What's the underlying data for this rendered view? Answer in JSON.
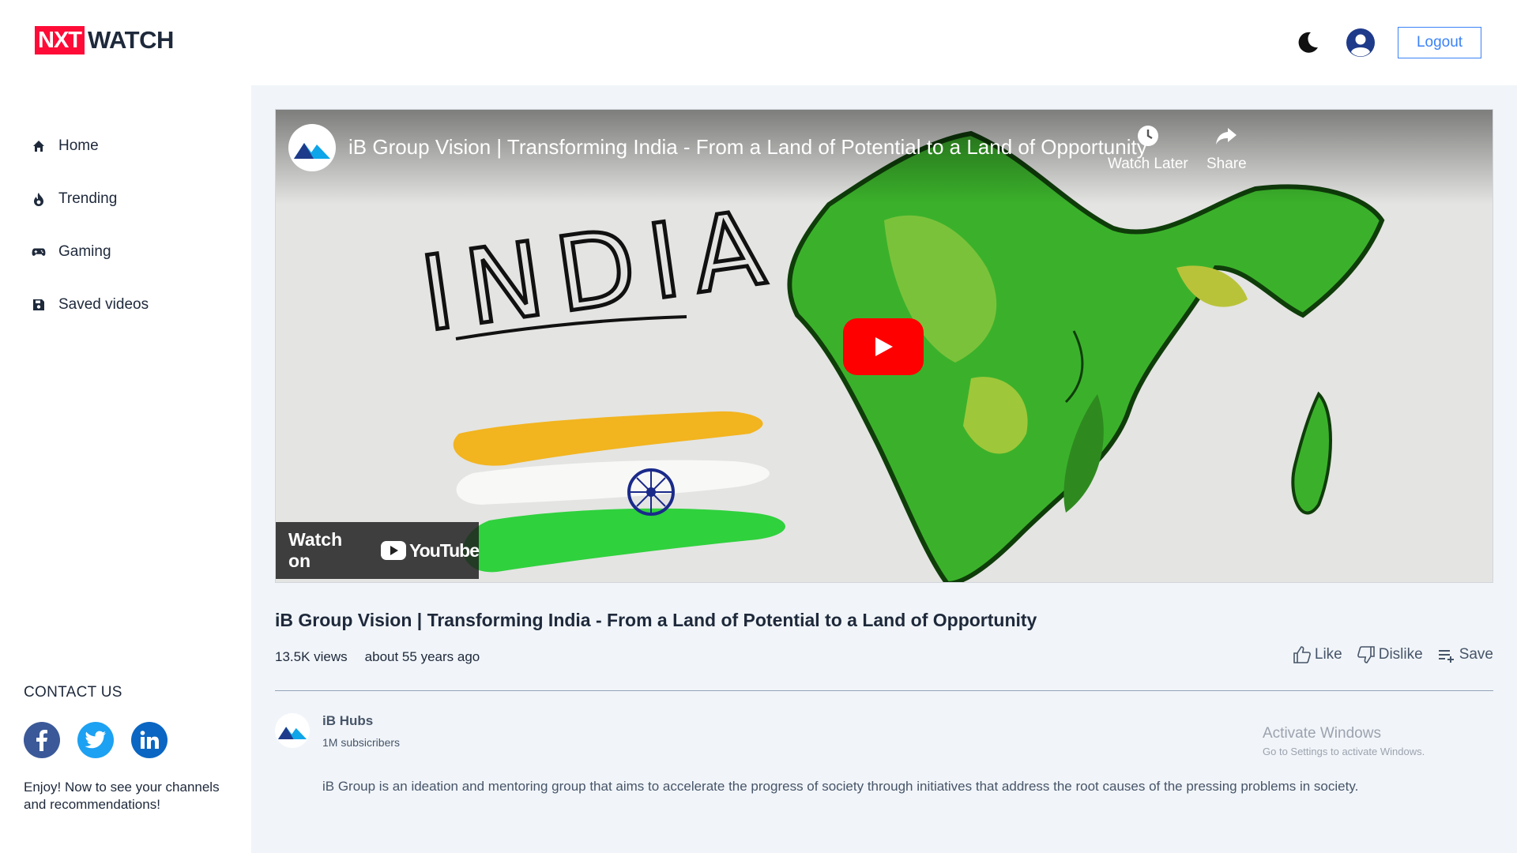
{
  "header": {
    "logo_part1": "NXT",
    "logo_part2": "WATCH",
    "logout_label": "Logout",
    "theme_icon": "moon-icon",
    "profile_icon": "profile-avatar-icon"
  },
  "sidebar": {
    "items": [
      {
        "label": "Home",
        "icon": "home-icon"
      },
      {
        "label": "Trending",
        "icon": "fire-icon"
      },
      {
        "label": "Gaming",
        "icon": "gamepad-icon"
      },
      {
        "label": "Saved videos",
        "icon": "save-icon"
      }
    ],
    "contact_title": "CONTACT US",
    "socials": [
      "facebook-icon",
      "twitter-icon",
      "linkedin-icon"
    ],
    "contact_text": "Enjoy! Now to see your channels and recommendations!"
  },
  "player": {
    "title": "iB Group Vision | Transforming India - From a Land of Potential to a Land of Opportunity",
    "watch_later": "Watch Later",
    "share": "Share",
    "watch_on": "Watch on",
    "youtube": "YouTube",
    "thumbnail_text": "INDIA"
  },
  "video": {
    "title": "iB Group Vision | Transforming India - From a Land of Potential to a Land of Opportunity",
    "views": "13.5K views",
    "published": "about 55 years ago",
    "like_label": "Like",
    "dislike_label": "Dislike",
    "save_label": "Save"
  },
  "channel": {
    "name": "iB Hubs",
    "subscribers": "1M subsicribers",
    "description": "iB Group is an ideation and mentoring group that aims to accelerate the progress of society through initiatives that address the root causes of the pressing problems in society."
  },
  "watermark": {
    "line1": "Activate Windows",
    "line2": "Go to Settings to activate Windows."
  },
  "colors": {
    "brand_red": "#ff0b37",
    "accent_blue": "#3b82f6",
    "main_bg": "#f1f5f9"
  }
}
